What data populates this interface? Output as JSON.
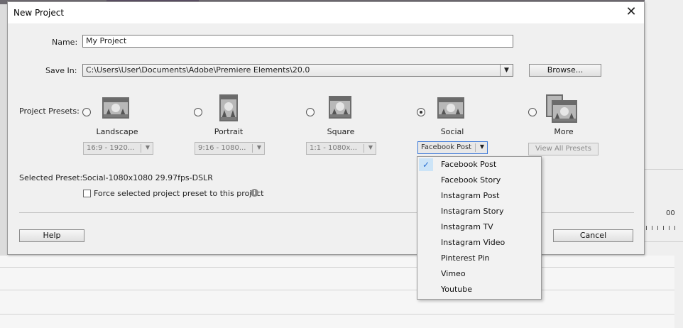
{
  "dialog": {
    "title": "New Project",
    "close_glyph": "✕"
  },
  "form": {
    "name_label": "Name:",
    "name_value": "My Project",
    "save_in_label": "Save In:",
    "save_in_value": "C:\\Users\\User\\Documents\\Adobe\\Premiere Elements\\20.0",
    "browse_label": "Browse...",
    "presets_label": "Project Presets:",
    "selected_preset_label": "Selected Preset:",
    "selected_preset_value": "Social-1080x1080 29.97fps-DSLR",
    "force_label": "Force selected project preset to this project"
  },
  "presets": [
    {
      "name": "Landscape",
      "option": "16:9 - 1920...",
      "selected": false,
      "icon": "landscape-icon"
    },
    {
      "name": "Portrait",
      "option": "9:16 - 1080...",
      "selected": false,
      "icon": "portrait-icon"
    },
    {
      "name": "Square",
      "option": "1:1 - 1080x...",
      "selected": false,
      "icon": "square-icon"
    },
    {
      "name": "Social",
      "option": "Facebook Post",
      "selected": true,
      "icon": "social-icon"
    },
    {
      "name": "More",
      "option": "View All Presets",
      "selected": false,
      "icon": "more-presets-icon"
    }
  ],
  "dropdown": {
    "checked_index": 0,
    "items": [
      "Facebook Post",
      "Facebook Story",
      "Instagram Post",
      "Instagram Story",
      "Instagram TV",
      "Instagram Video",
      "Pinterest Pin",
      "Vimeo",
      "Youtube"
    ]
  },
  "buttons": {
    "help": "Help",
    "cancel": "Cancel"
  },
  "background": {
    "ruler_number": "00"
  }
}
